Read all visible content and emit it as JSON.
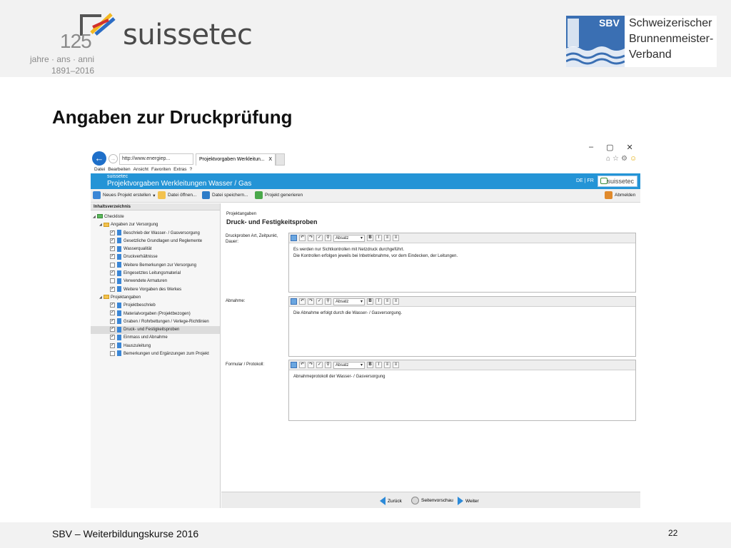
{
  "header": {
    "logo_left": {
      "anniversary": "125",
      "name": "suissetec",
      "years": "jahre · ans · anni",
      "range": "1891–2016"
    },
    "logo_right": {
      "abbr": "SBV",
      "line1": "Schweizerischer",
      "line2": "Brunnenmeister-",
      "line3": "Verband"
    }
  },
  "slide_title": "Angaben zur Druckprüfung",
  "browser": {
    "address": "http://www.energiep...",
    "tab_label": "Projektvorgaben Werkleitun...",
    "tab_close": "X",
    "window_controls": [
      "–",
      "▢",
      "✕"
    ],
    "menu": [
      "Datei",
      "Bearbeiten",
      "Ansicht",
      "Favoriten",
      "Extras",
      "?"
    ]
  },
  "app": {
    "brand_small": "suissetec",
    "title": "Projektvorgaben Werkleitungen Wasser / Gas",
    "language": "DE | FR",
    "logo_text": "suissetec",
    "toolbar": {
      "new_project": "Neues Projekt erstellen",
      "open_file": "Datei öffnen...",
      "save_file": "Datei speichern...",
      "generate": "Projekt generieren",
      "logout": "Abmelden"
    },
    "tree": {
      "header": "Inhaltsverzeichnis",
      "items": [
        {
          "label": "Checkliste"
        },
        {
          "label": "Angaben zur Versorgung"
        },
        {
          "label": "Beschrieb der Wasser- / Gasversorgung"
        },
        {
          "label": "Gesetzliche Grundlagen und Reglemente"
        },
        {
          "label": "Wasserqualität"
        },
        {
          "label": "Druckverhältnisse"
        },
        {
          "label": "Weitere Bemerkungen zur Versorgung"
        },
        {
          "label": "Eingesetztes Leitungsmaterial"
        },
        {
          "label": "Verwendete Armaturen"
        },
        {
          "label": "Weitere Vorgaben des Werkes"
        },
        {
          "label": "Projektangaben"
        },
        {
          "label": "Projektbeschrieb"
        },
        {
          "label": "Materialvorgaben (Projektbezogen)"
        },
        {
          "label": "Graben / Rohrbettungen / Verlege-Richtlinien"
        },
        {
          "label": "Druck- und Festigkeitsproben"
        },
        {
          "label": "Einmass und Abnahme"
        },
        {
          "label": "Hauszuleitung"
        },
        {
          "label": "Bemerkungen und Ergänzungen zum Projekt"
        }
      ]
    },
    "content": {
      "section_label": "Projektangaben",
      "section_title": "Druck- und Festigkeitsproben",
      "editor_style": "Absatz",
      "fields": [
        {
          "label": "Druckproben Art, Zeitpunkt, Dauer:",
          "line1": "Es werden nur Sichtkontrollen mit Netzdruck durchgeführt.",
          "line2": "Die Kontrollen erfolgen jeweils bei Inbetriebnahme, vor dem Eindecken, der Leitungen."
        },
        {
          "label": "Abnahme:",
          "line1": "Die Abnahme erfolgt durch die Wasser- / Gasversorgung.",
          "line2": ""
        },
        {
          "label": "Formular / Protokoll:",
          "line1": "Abnahmeprotokoll der Wasser- / Gasversorgung",
          "line2": ""
        }
      ]
    },
    "nav": {
      "back": "Zurück",
      "preview": "Seitenvorschau",
      "next": "Weiter"
    }
  },
  "footer": {
    "left": "SBV – Weiterbildungskurse 2016",
    "page": "22"
  },
  "colors": {
    "app_blue": "#2494d6",
    "header_gray": "#f2f2f2",
    "folder_yellow": "#f3c24f"
  }
}
